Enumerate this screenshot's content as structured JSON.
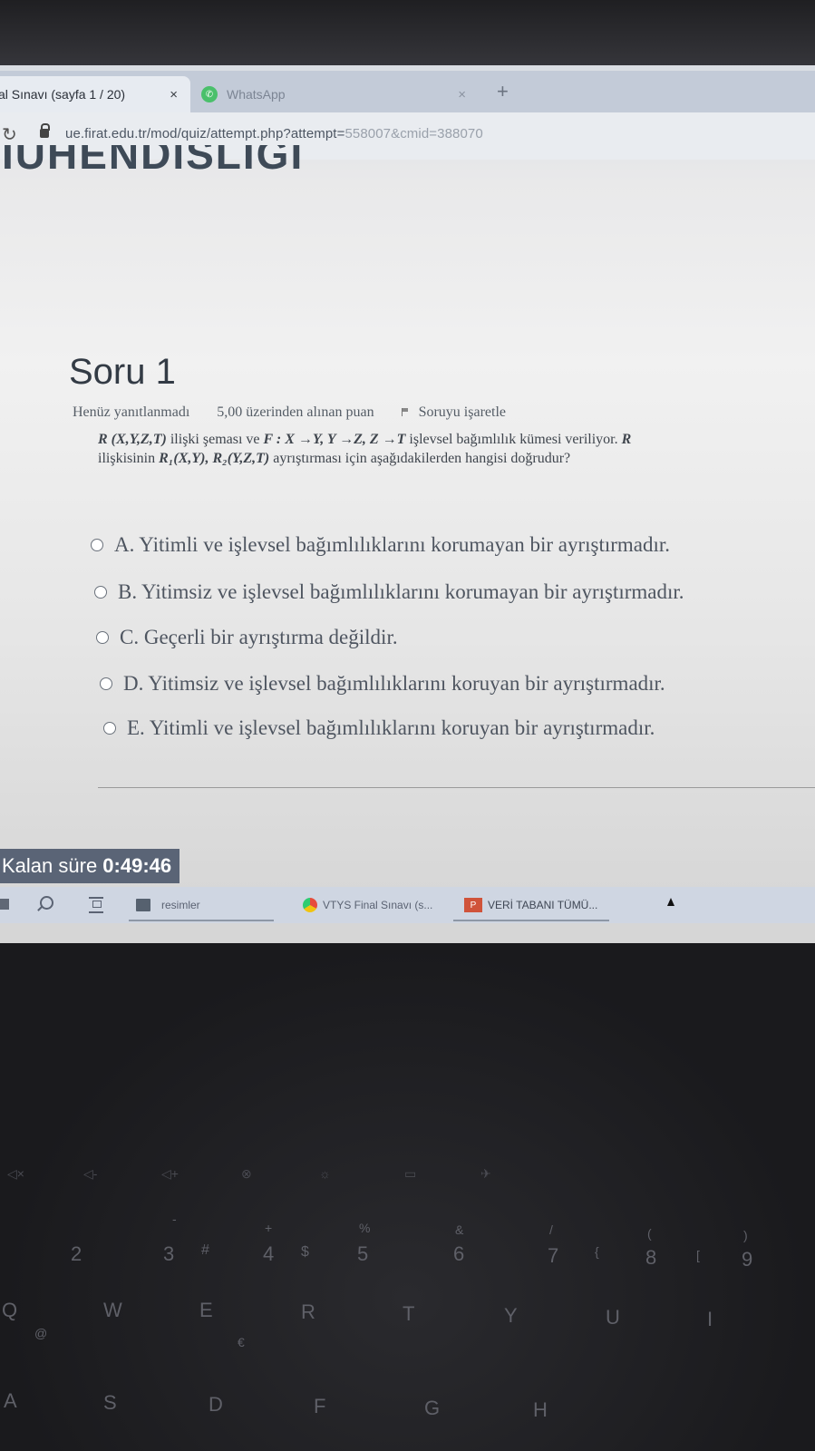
{
  "browser": {
    "active_tab_title": "al Sınavı (sayfa 1 / 20)",
    "second_tab_title": "WhatsApp",
    "close_glyph": "×",
    "new_tab_glyph": "+",
    "url_main": "ue.firat.edu.tr/mod/quiz/attempt.php?attempt=",
    "url_dim": "558007&cmid=388070"
  },
  "page": {
    "heading_fragment": "IUHENDISLIGI",
    "question_title": "Soru 1",
    "status": "Henüz yanıtlanmadı",
    "points": "5,00 üzerinden alınan puan",
    "flag_label": "Soruyu işaretle",
    "question_text_html_parts": {
      "line1_a": "R (X,Y,Z,T)",
      "line1_b": " ilişki şeması ve ",
      "line1_c": "F : X →Y, Y →Z, Z →T",
      "line1_d": " işlevsel bağımlılık kümesi veriliyor. ",
      "line1_e": "R",
      "line2_a": "ilişkisinin ",
      "line2_b": "R₁(X,Y), R₂(Y,Z,T)",
      "line2_c": " ayrıştırması için aşağıdakilerden hangisi doğrudur?"
    },
    "options": [
      "A. Yitimli ve işlevsel bağımlılıklarını korumayan bir ayrıştırmadır.",
      "B. Yitimsiz ve işlevsel bağımlılıklarını korumayan bir ayrıştırmadır.",
      "C. Geçerli bir ayrıştırma değildir.",
      "D. Yitimsiz ve işlevsel bağımlılıklarını koruyan bir ayrıştırmadır.",
      "E. Yitimli ve işlevsel bağımlılıklarını koruyan bir ayrıştırmadır."
    ],
    "timer_label": "Kalan süre ",
    "timer_value": "0:49:46"
  },
  "taskbar": {
    "folder_label": "resimler",
    "chrome_label": "VTYS Final Sınavı (s...",
    "ppt_label": "VERİ TABANI TÜMÜ..."
  },
  "keyboard": {
    "number_row": [
      "2",
      "3",
      "4",
      "5",
      "6",
      "7",
      "8",
      "9"
    ],
    "symbol_row": [
      "#",
      "$",
      "%",
      "&",
      "/",
      "(",
      ")"
    ],
    "letter_row": [
      "Q",
      "W",
      "E",
      "R",
      "T",
      "Y",
      "U",
      "I"
    ],
    "home_row": [
      "A",
      "S",
      "D",
      "F",
      "G",
      "H"
    ],
    "extra_symbols": [
      "€",
      "@",
      "[",
      "{",
      "+",
      "-"
    ]
  }
}
